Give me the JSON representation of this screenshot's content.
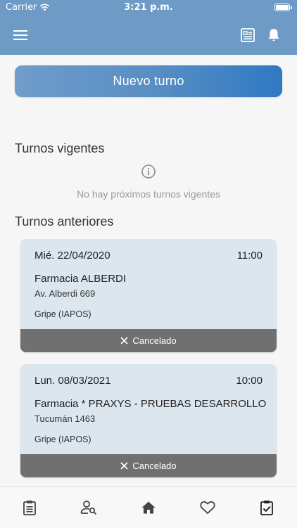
{
  "status_bar": {
    "carrier": "Carrier",
    "time": "3:21 p.m."
  },
  "app_bar": {
    "menu_icon": "menu-icon",
    "report_icon": "report-icon",
    "bell_icon": "bell-icon",
    "background": "#6e9bc6"
  },
  "new_button": {
    "label": "Nuevo turno"
  },
  "vigentes": {
    "title": "Turnos vigentes",
    "empty_message": "No hay próximos turnos vigentes"
  },
  "anteriores": {
    "title": "Turnos anteriores",
    "items": [
      {
        "date": "Mié. 22/04/2020",
        "hour": "11:00",
        "pharmacy": "Farmacia ALBERDI",
        "address": "Av. Alberdi 669",
        "service": "Gripe (IAPOS)",
        "status": "Cancelado"
      },
      {
        "date": "Lun. 08/03/2021",
        "hour": "10:00",
        "pharmacy": "Farmacia * PRAXYS - PRUEBAS DESARROLLO",
        "address": "Tucumán 1463",
        "service": "Gripe (IAPOS)",
        "status": "Cancelado"
      }
    ]
  },
  "bottom_nav": {
    "items": [
      "clipboard-icon",
      "user-search-icon",
      "home-icon",
      "heart-icon",
      "clipboard-check-icon"
    ]
  },
  "colors": {
    "accent": "#2f79c3",
    "card_bg": "#dce6ee",
    "status_bg": "#707070"
  }
}
